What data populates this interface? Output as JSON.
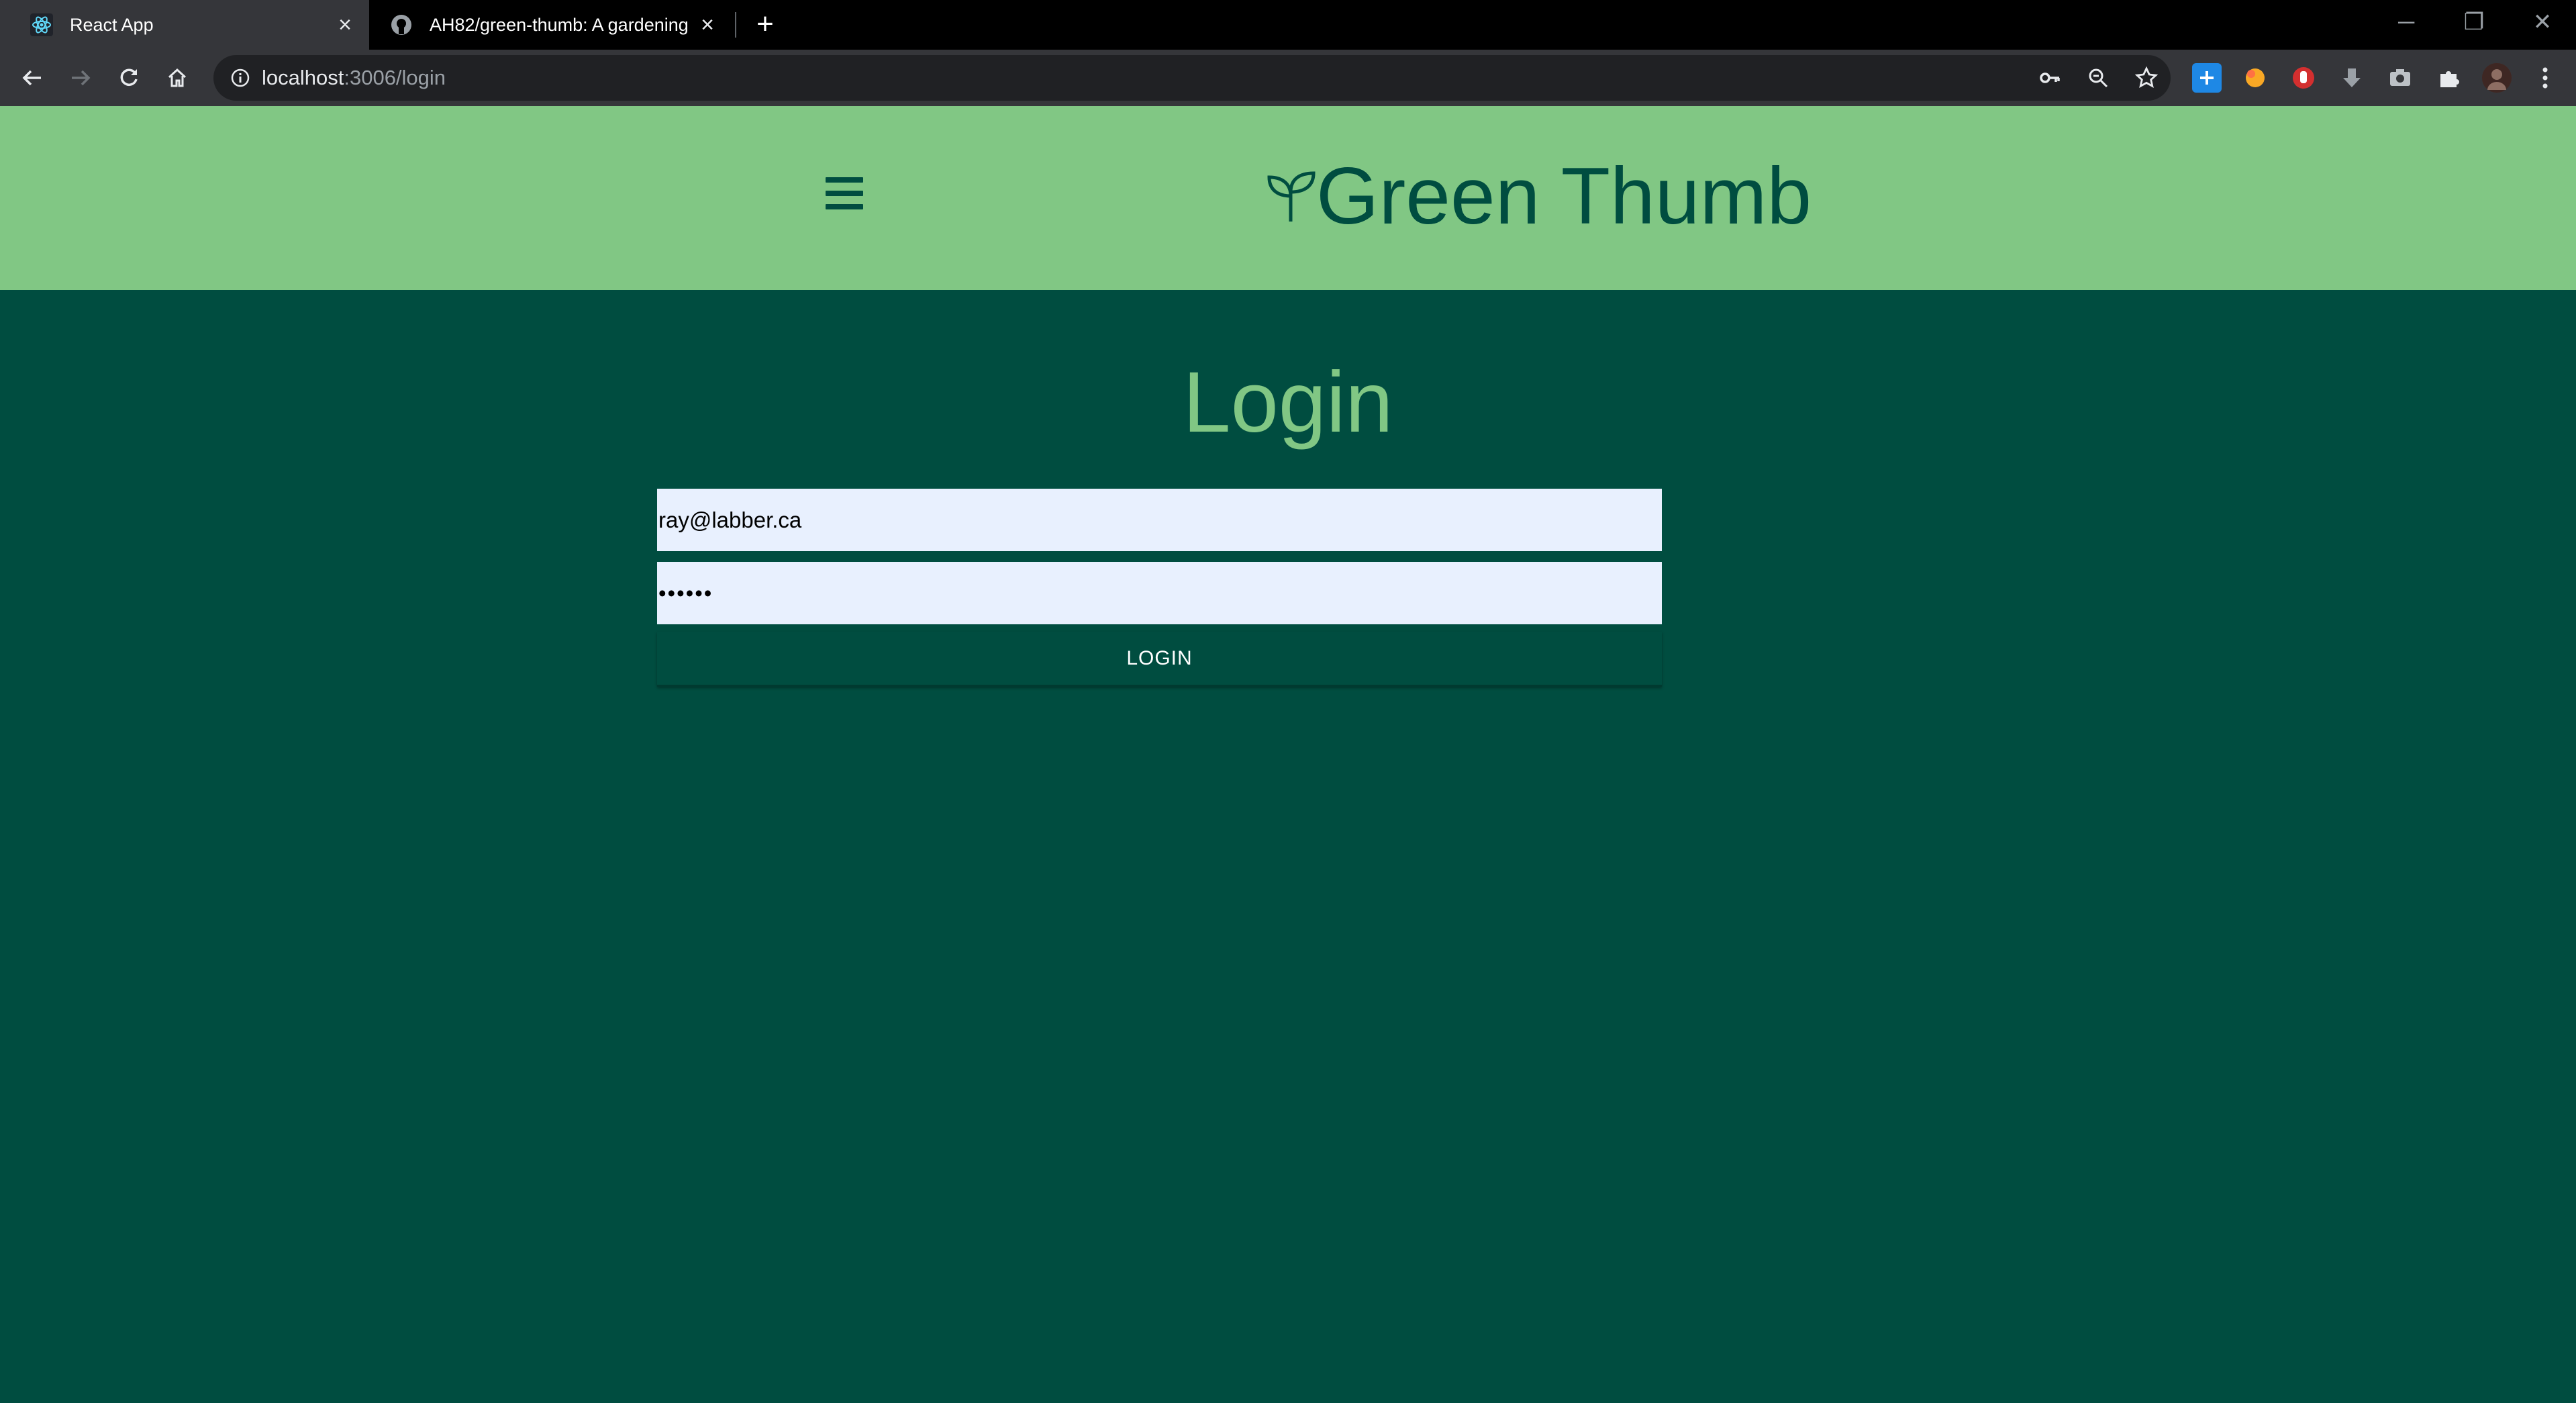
{
  "browser": {
    "tabs": [
      {
        "title": "React App",
        "active": true,
        "icon": "react-icon"
      },
      {
        "title": "AH82/green-thumb: A gardening",
        "active": false,
        "icon": "github-icon"
      }
    ],
    "close_glyph": "×",
    "new_tab_glyph": "+",
    "url_host": "localhost",
    "url_path": ":3006/login",
    "window_controls": {
      "minimize": "─",
      "restore": "❐",
      "close": "✕"
    }
  },
  "app": {
    "brand_name": "Green Thumb",
    "header_color": "#81c784",
    "background_color": "#004d40"
  },
  "login": {
    "title": "Login",
    "email_value": "ray@labber.ca",
    "password_value": "••••••",
    "button_label": "LOGIN"
  }
}
